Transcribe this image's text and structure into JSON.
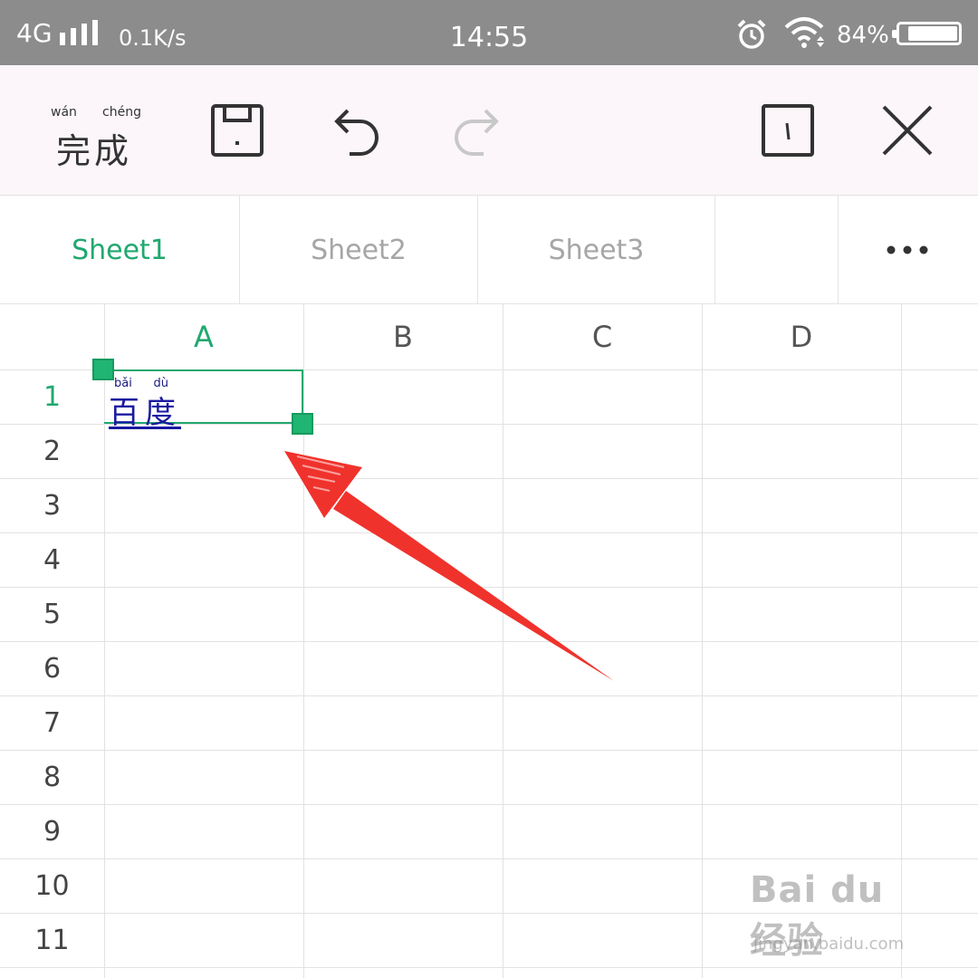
{
  "status_bar": {
    "network": "4G",
    "speed": "0.1K/s",
    "time": "14:55",
    "battery_percent": "84%",
    "battery_level": 0.84,
    "icons": [
      "signal-icon",
      "alarm-icon",
      "wifi-icon",
      "battery-icon"
    ]
  },
  "toolbar": {
    "done_pinyin": [
      "wán",
      "chéng"
    ],
    "done_label": "完成",
    "icons": [
      "save-icon",
      "undo-icon",
      "redo-icon",
      "cell-edit-icon",
      "close-icon"
    ],
    "redo_enabled": false
  },
  "sheet_tabs": {
    "tabs": [
      {
        "label": "Sheet1",
        "active": true
      },
      {
        "label": "Sheet2",
        "active": false
      },
      {
        "label": "Sheet3",
        "active": false
      }
    ],
    "more_icon": "more-horizontal-icon"
  },
  "grid": {
    "columns": [
      "A",
      "B",
      "C",
      "D"
    ],
    "rows": [
      "1",
      "2",
      "3",
      "4",
      "5",
      "6",
      "7",
      "8",
      "9",
      "10",
      "11"
    ],
    "selected_cell": "A1",
    "cell_A1": {
      "text": "百度",
      "pinyin": [
        "bǎi",
        "dù"
      ]
    }
  },
  "annotation": {
    "type": "red-arrow",
    "target": "A1",
    "color": "#f0322c"
  },
  "watermark": {
    "brand": "Bai du 经验",
    "url": "jingyan.baidu.com"
  },
  "colors": {
    "accent": "#20a86f",
    "status_bar": "#8c8c8c",
    "toolbar_bg": "#fcf6fa",
    "cell_text": "#1a1aa0"
  }
}
